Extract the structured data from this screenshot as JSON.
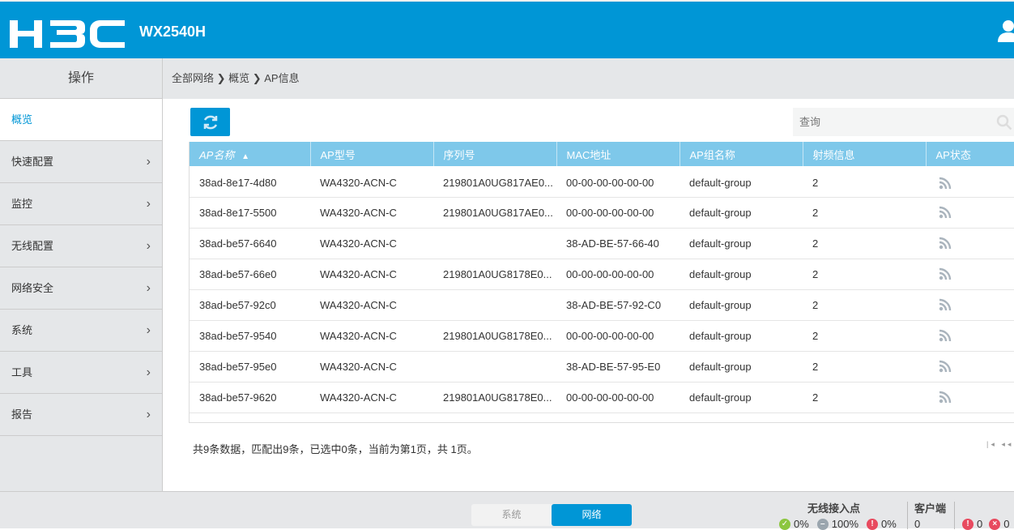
{
  "header": {
    "logo": "H3C",
    "model": "WX2540H"
  },
  "sidebar": {
    "title": "操作",
    "items": [
      {
        "label": "概览",
        "active": true
      },
      {
        "label": "快速配置"
      },
      {
        "label": "监控"
      },
      {
        "label": "无线配置"
      },
      {
        "label": "网络安全"
      },
      {
        "label": "系统"
      },
      {
        "label": "工具"
      },
      {
        "label": "报告"
      }
    ]
  },
  "breadcrumb": "全部网络 ❯ 概览 ❯ AP信息",
  "search": {
    "placeholder": "查询"
  },
  "table": {
    "columns": [
      "AP名称",
      "AP型号",
      "序列号",
      "MAC地址",
      "AP组名称",
      "射频信息",
      "AP状态"
    ],
    "rows": [
      [
        "38ad-8e17-4d80",
        "WA4320-ACN-C",
        "219801A0UG817AE0...",
        "00-00-00-00-00-00",
        "default-group",
        "2"
      ],
      [
        "38ad-8e17-5500",
        "WA4320-ACN-C",
        "219801A0UG817AE0...",
        "00-00-00-00-00-00",
        "default-group",
        "2"
      ],
      [
        "38ad-be57-6640",
        "WA4320-ACN-C",
        "",
        "38-AD-BE-57-66-40",
        "default-group",
        "2"
      ],
      [
        "38ad-be57-66e0",
        "WA4320-ACN-C",
        "219801A0UG8178E0...",
        "00-00-00-00-00-00",
        "default-group",
        "2"
      ],
      [
        "38ad-be57-92c0",
        "WA4320-ACN-C",
        "",
        "38-AD-BE-57-92-C0",
        "default-group",
        "2"
      ],
      [
        "38ad-be57-9540",
        "WA4320-ACN-C",
        "219801A0UG8178E0...",
        "00-00-00-00-00-00",
        "default-group",
        "2"
      ],
      [
        "38ad-be57-95e0",
        "WA4320-ACN-C",
        "",
        "38-AD-BE-57-95-E0",
        "default-group",
        "2"
      ],
      [
        "38ad-be57-9620",
        "WA4320-ACN-C",
        "219801A0UG8178E0...",
        "00-00-00-00-00-00",
        "default-group",
        "2"
      ]
    ]
  },
  "summary": "共9条数据，匹配出9条，已选中0条，当前为第1页，共 1页。",
  "bottom": {
    "tabs": [
      "系统",
      "网络"
    ],
    "ap_title": "无线接入点",
    "ap_ok": "0%",
    "ap_off": "100%",
    "ap_err": "0%",
    "client_title": "客户端",
    "client_count": "0",
    "alarm_warn": "0",
    "alarm_err": "0"
  },
  "colors": {
    "brand": "#0096d6",
    "table_header": "#7ec8ea"
  }
}
